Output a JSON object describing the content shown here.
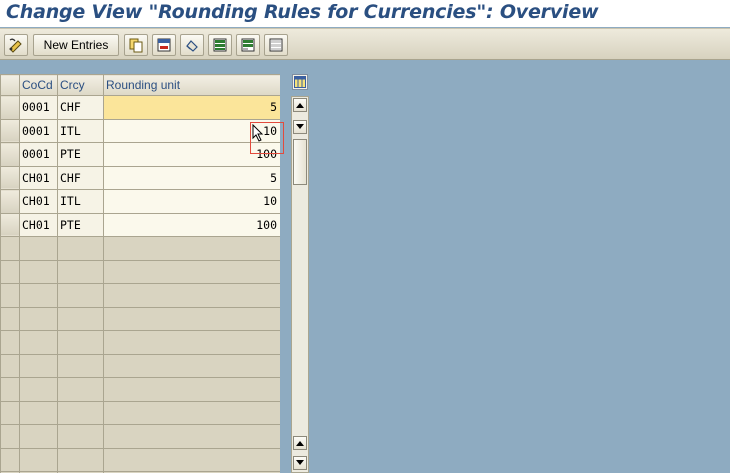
{
  "window": {
    "title": "Change View \"Rounding Rules for Currencies\": Overview"
  },
  "toolbar": {
    "new_entries_label": "New Entries",
    "icons": [
      "display-change-icon",
      "copy-icon",
      "delete-icon",
      "undo-icon",
      "select-all-icon",
      "select-block-icon",
      "deselect-all-icon"
    ]
  },
  "table": {
    "columns": [
      "CoCd",
      "Crcy",
      "Rounding unit"
    ],
    "rows": [
      {
        "cocd": "0001",
        "crcy": "CHF",
        "unit": "5"
      },
      {
        "cocd": "0001",
        "crcy": "ITL",
        "unit": "10"
      },
      {
        "cocd": "0001",
        "crcy": "PTE",
        "unit": "100"
      },
      {
        "cocd": "CH01",
        "crcy": "CHF",
        "unit": "5"
      },
      {
        "cocd": "CH01",
        "crcy": "ITL",
        "unit": "10"
      },
      {
        "cocd": "CH01",
        "crcy": "PTE",
        "unit": "100"
      }
    ],
    "active_row": 0
  },
  "colors": {
    "title": "#2a4f81",
    "background": "#8eabc1",
    "active_cell": "#fbe59a"
  }
}
